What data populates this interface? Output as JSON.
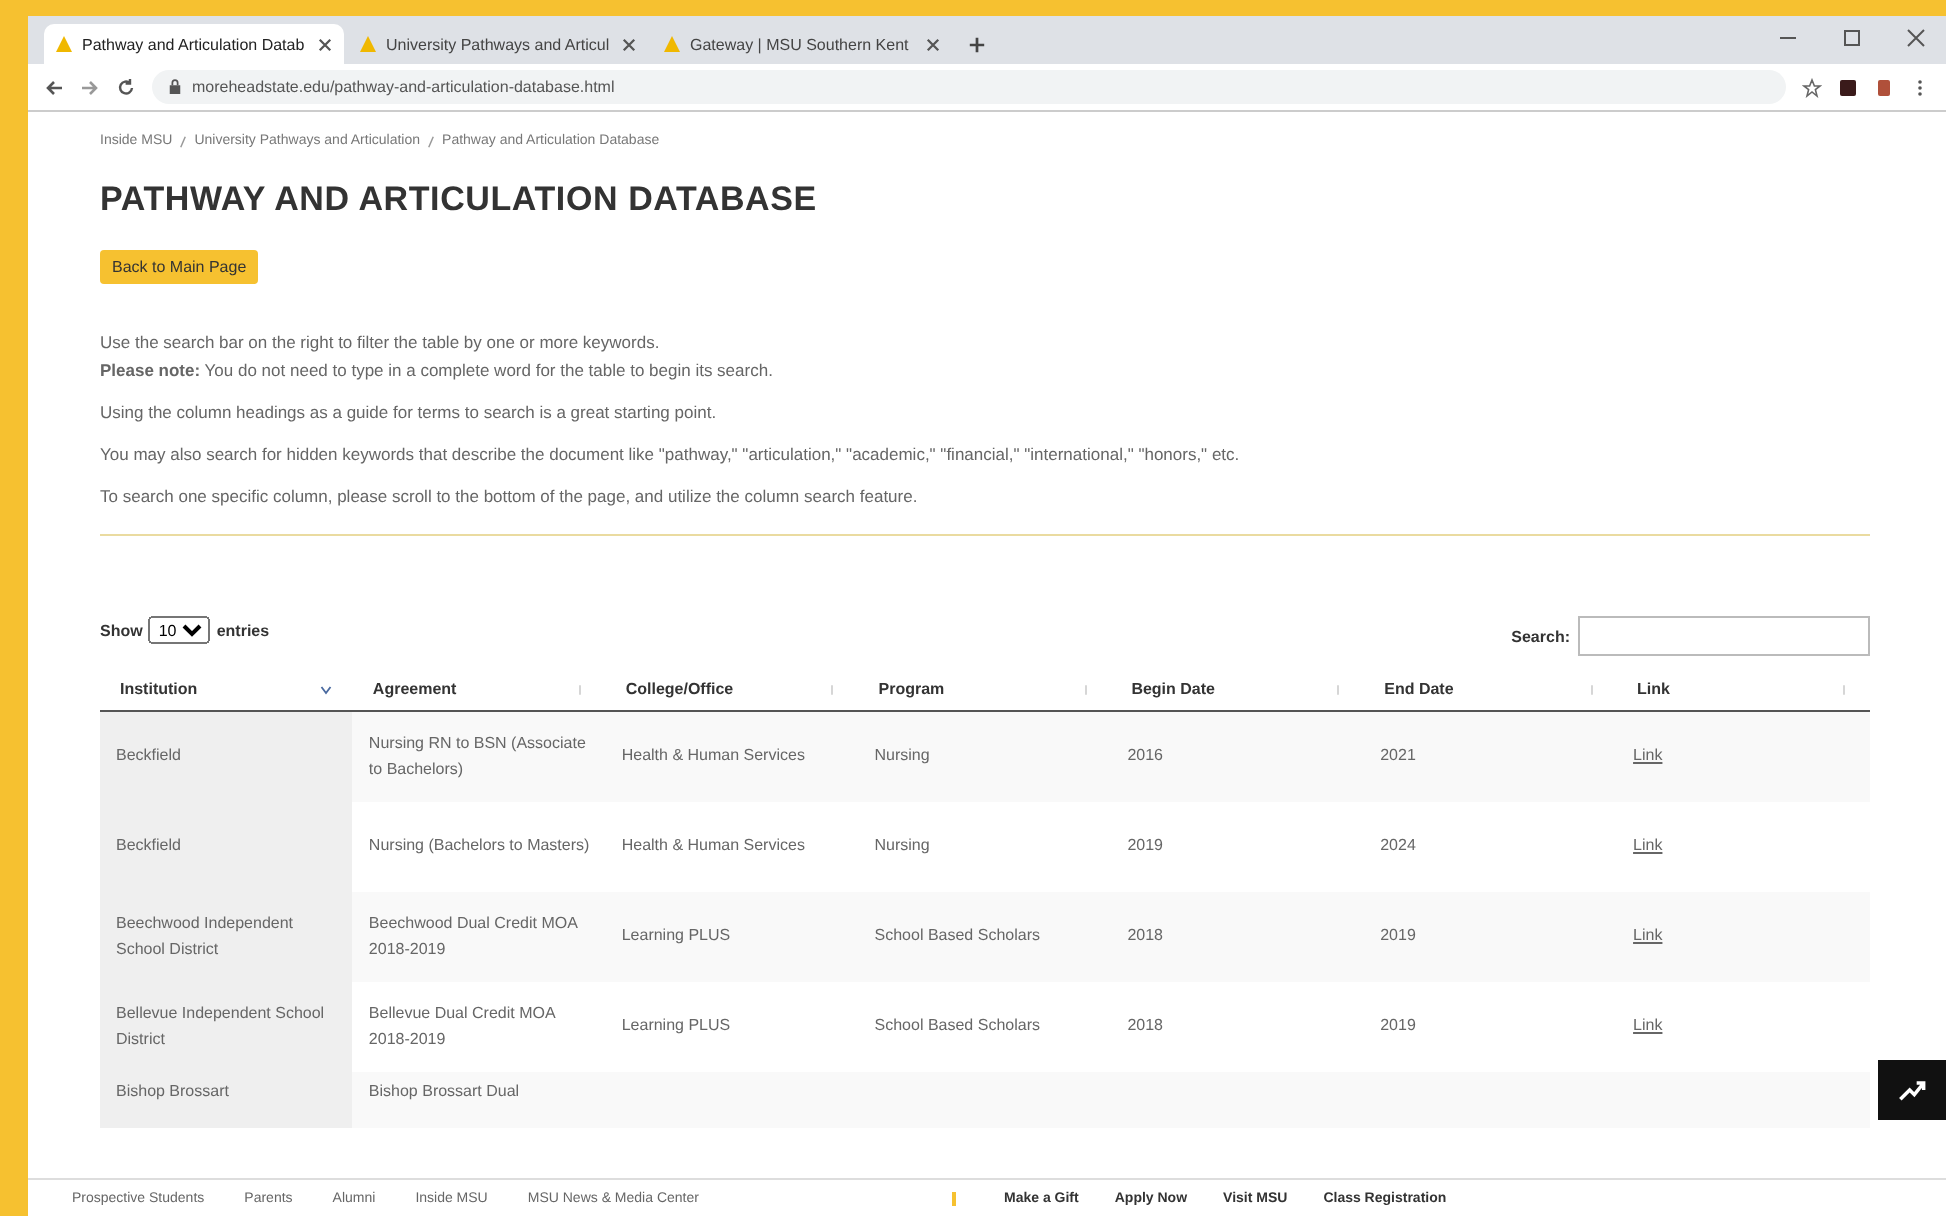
{
  "browser": {
    "tabs": [
      {
        "title": "Pathway and Articulation Datab",
        "selected": true
      },
      {
        "title": "University Pathways and Articul",
        "selected": false
      },
      {
        "title": "Gateway | MSU Southern Kent",
        "selected": false
      }
    ],
    "url": "moreheadstate.edu/pathway-and-articulation-database.html"
  },
  "breadcrumb": [
    "Inside MSU",
    "University Pathways and Articulation",
    "Pathway and Articulation Database"
  ],
  "page_title": "PATHWAY AND ARTICULATION DATABASE",
  "back_button": "Back to Main Page",
  "instructions": [
    "Use the search bar on the right to filter the table by one or more keywords.",
    "**Please note:** You do not need to type in a complete word for the table to begin its search.",
    "Using the column headings as a guide for terms to search is a great starting point.",
    "You may also search for hidden keywords that describe the document like \"pathway,\" \"articulation,\" \"academic,\" \"financial,\" \"international,\" \"honors,\" etc.",
    "To search one specific column, please scroll to the bottom of the page, and utilize the column search feature."
  ],
  "length_control": {
    "before": "Show",
    "value": "10",
    "after": "entries"
  },
  "search": {
    "label": "Search:"
  },
  "table": {
    "columns": [
      {
        "label": "Institution",
        "sorted": true
      },
      {
        "label": "Agreement",
        "sorted": false
      },
      {
        "label": "College/Office",
        "sorted": false
      },
      {
        "label": "Program",
        "sorted": false
      },
      {
        "label": "Begin Date",
        "sorted": false
      },
      {
        "label": "End Date",
        "sorted": false
      },
      {
        "label": "Link",
        "sorted": false
      }
    ],
    "rows": [
      {
        "cells": [
          "Beckfield",
          "Nursing RN to BSN (Associate to Bachelors)",
          "Health & Human Services",
          "Nursing",
          "2016",
          "2021",
          "Link"
        ]
      },
      {
        "cells": [
          "Beckfield",
          "Nursing (Bachelors to Masters)",
          "Health & Human Services",
          "Nursing",
          "2019",
          "2024",
          "Link"
        ]
      },
      {
        "cells": [
          "Beechwood Independent School District",
          "Beechwood Dual Credit MOA 2018-2019",
          "Learning PLUS",
          "School Based Scholars",
          "2018",
          "2019",
          "Link"
        ]
      },
      {
        "cells": [
          "Bellevue Independent School District",
          "Bellevue Dual Credit MOA 2018-2019",
          "Learning PLUS",
          "School Based Scholars",
          "2018",
          "2019",
          "Link"
        ]
      },
      {
        "cells": [
          "Bishop Brossart",
          "Bishop Brossart Dual"
        ]
      }
    ]
  },
  "footer": {
    "links": [
      "Prospective Students",
      "Parents",
      "Alumni",
      "Inside MSU",
      "MSU News & Media Center"
    ],
    "actions": [
      "Make a Gift",
      "Apply Now",
      "Visit MSU",
      "Class Registration"
    ]
  }
}
